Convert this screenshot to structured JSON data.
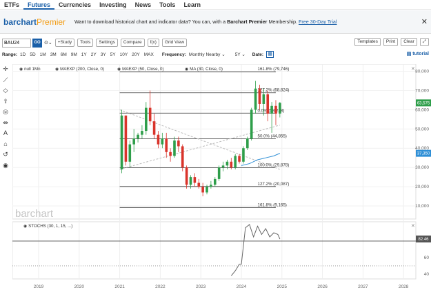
{
  "topnav": {
    "items": [
      "ETFs",
      "Futures",
      "Currencies",
      "Investing",
      "News",
      "Tools",
      "Learn"
    ],
    "active": "Futures"
  },
  "promo": {
    "logo_main": "barchart",
    "logo_accent": "Premier",
    "text": "Want to download historical chart and indicator data? You can, with a",
    "text_bold": "Barchart Premier",
    "text_after": "Membership.",
    "link": "Free 30-Day Trial",
    "close": "✕"
  },
  "toolbar": {
    "symbol": "BAU24",
    "go": "GO",
    "type_icon": "⊙⌄",
    "buttons": [
      "+Study",
      "Tools",
      "Settings",
      "Compare",
      "f(x)",
      "Grid View"
    ],
    "right_buttons": [
      "Templates",
      "Print",
      "Clear"
    ],
    "expand_icon": "⤢"
  },
  "rangebar": {
    "range_label": "Range:",
    "ranges": [
      "1D",
      "5D",
      "1M",
      "3M",
      "6M",
      "9M",
      "1Y",
      "2Y",
      "3Y",
      "5Y",
      "10Y",
      "20Y",
      "MAX"
    ],
    "freq_label": "Frequency:",
    "freq_value": "Monthly Nearby",
    "period_value": "5Y",
    "date_label": "Date:",
    "tutorial": "tutorial"
  },
  "sidetools": [
    "crosshair-icon",
    "line-icon",
    "shape-icon",
    "arrow-icon",
    "circle-icon",
    "measure-icon",
    "text-icon",
    "lock-icon",
    "undo-icon",
    "eye-icon"
  ],
  "legend": {
    "items": [
      "null 1Mn",
      "MAEXP (200, Close, 0)",
      "MAEXP (50, Close, 0)",
      "MA (30, Close, 0)"
    ]
  },
  "watermark": "barchart",
  "price_axis": [
    "80,000",
    "70,000",
    "60,000",
    "50,000",
    "40,000",
    "30,000",
    "20,000",
    "10,000"
  ],
  "price_badges": {
    "last": "63,575",
    "ma": "37,350"
  },
  "fib_levels": [
    {
      "label": "161.8% (79,746)",
      "value": 79746
    },
    {
      "label": "127.2% (68,824)",
      "value": 68824
    },
    {
      "label": "0.0% (58,238)",
      "value": 58238
    },
    {
      "label": "50.0% (44,855)",
      "value": 44855
    },
    {
      "label": "100.0% (29,878)",
      "value": 29878
    },
    {
      "label": "127.2% (20,087)",
      "value": 20087
    },
    {
      "label": "161.8% (9,165)",
      "value": 9165
    }
  ],
  "stoch": {
    "label": "STOCHS (30, 1, 15, ...)",
    "axis": [
      "80",
      "60",
      "40"
    ],
    "badge": "82.46"
  },
  "time_axis": [
    "2019",
    "2020",
    "2021",
    "2022",
    "2023",
    "2024",
    "2025",
    "2026",
    "2027",
    "2028"
  ],
  "chart_data": {
    "type": "candlestick",
    "ylim": [
      0,
      85000
    ],
    "candles": [
      {
        "t": 2021.05,
        "o": 29000,
        "h": 60000,
        "l": 27000,
        "c": 57000
      },
      {
        "t": 2021.15,
        "o": 57000,
        "h": 57000,
        "l": 31000,
        "c": 33000
      },
      {
        "t": 2021.25,
        "o": 33000,
        "h": 44000,
        "l": 30000,
        "c": 42000
      },
      {
        "t": 2021.35,
        "o": 42000,
        "h": 50000,
        "l": 38000,
        "c": 45000
      },
      {
        "t": 2021.45,
        "o": 45000,
        "h": 48000,
        "l": 43000,
        "c": 47000
      },
      {
        "t": 2021.55,
        "o": 47000,
        "h": 52000,
        "l": 45000,
        "c": 49000
      },
      {
        "t": 2021.65,
        "o": 49000,
        "h": 64000,
        "l": 47000,
        "c": 61000
      },
      {
        "t": 2021.75,
        "o": 61000,
        "h": 70000,
        "l": 52000,
        "c": 54000
      },
      {
        "t": 2021.85,
        "o": 54000,
        "h": 58000,
        "l": 45000,
        "c": 47000
      },
      {
        "t": 2021.95,
        "o": 47000,
        "h": 49000,
        "l": 40000,
        "c": 42000
      },
      {
        "t": 2022.05,
        "o": 42000,
        "h": 48000,
        "l": 40000,
        "c": 45000
      },
      {
        "t": 2022.15,
        "o": 45000,
        "h": 48000,
        "l": 35000,
        "c": 38000
      },
      {
        "t": 2022.25,
        "o": 38000,
        "h": 40000,
        "l": 33000,
        "c": 36000
      },
      {
        "t": 2022.35,
        "o": 36000,
        "h": 46000,
        "l": 35000,
        "c": 44000
      },
      {
        "t": 2022.45,
        "o": 44000,
        "h": 46000,
        "l": 38000,
        "c": 41000
      },
      {
        "t": 2022.55,
        "o": 41000,
        "h": 42000,
        "l": 28000,
        "c": 30000
      },
      {
        "t": 2022.65,
        "o": 30000,
        "h": 31000,
        "l": 19000,
        "c": 21000
      },
      {
        "t": 2022.75,
        "o": 21000,
        "h": 26000,
        "l": 19000,
        "c": 25000
      },
      {
        "t": 2022.85,
        "o": 25000,
        "h": 27000,
        "l": 20000,
        "c": 22000
      },
      {
        "t": 2022.95,
        "o": 22000,
        "h": 24000,
        "l": 19000,
        "c": 20000
      },
      {
        "t": 2023.05,
        "o": 20000,
        "h": 22000,
        "l": 15000,
        "c": 17000
      },
      {
        "t": 2023.15,
        "o": 17000,
        "h": 21000,
        "l": 16000,
        "c": 20000
      },
      {
        "t": 2023.25,
        "o": 20000,
        "h": 23000,
        "l": 19000,
        "c": 21000
      },
      {
        "t": 2023.35,
        "o": 21000,
        "h": 25000,
        "l": 20000,
        "c": 24000
      },
      {
        "t": 2023.45,
        "o": 24000,
        "h": 31000,
        "l": 23000,
        "c": 30000
      },
      {
        "t": 2023.55,
        "o": 30000,
        "h": 33000,
        "l": 28000,
        "c": 31000
      },
      {
        "t": 2023.65,
        "o": 31000,
        "h": 34000,
        "l": 29000,
        "c": 33000
      },
      {
        "t": 2023.75,
        "o": 33000,
        "h": 35000,
        "l": 29000,
        "c": 30000
      },
      {
        "t": 2023.85,
        "o": 30000,
        "h": 37000,
        "l": 29000,
        "c": 36000
      },
      {
        "t": 2023.95,
        "o": 36000,
        "h": 37000,
        "l": 32000,
        "c": 33000
      },
      {
        "t": 2024.05,
        "o": 33000,
        "h": 41000,
        "l": 32000,
        "c": 40000
      },
      {
        "t": 2024.15,
        "o": 40000,
        "h": 46000,
        "l": 39000,
        "c": 45000
      },
      {
        "t": 2024.25,
        "o": 45000,
        "h": 61000,
        "l": 44000,
        "c": 60000
      },
      {
        "t": 2024.35,
        "o": 60000,
        "h": 75000,
        "l": 58000,
        "c": 71000
      },
      {
        "t": 2024.45,
        "o": 71000,
        "h": 73000,
        "l": 60000,
        "c": 63000
      },
      {
        "t": 2024.55,
        "o": 63000,
        "h": 71000,
        "l": 57000,
        "c": 68000
      },
      {
        "t": 2024.65,
        "o": 68000,
        "h": 70000,
        "l": 54000,
        "c": 58000
      },
      {
        "t": 2024.75,
        "o": 58000,
        "h": 64000,
        "l": 48000,
        "c": 62000
      },
      {
        "t": 2024.85,
        "o": 62000,
        "h": 65000,
        "l": 52000,
        "c": 58000
      },
      {
        "t": 2024.95,
        "o": 58000,
        "h": 64000,
        "l": 56000,
        "c": 63575
      }
    ],
    "ma_line": [
      [
        2024.0,
        31000
      ],
      [
        2024.2,
        32000
      ],
      [
        2024.4,
        34000
      ],
      [
        2024.6,
        35000
      ],
      [
        2024.8,
        36000
      ],
      [
        2024.95,
        37350
      ]
    ],
    "stoch_line": [
      [
        2023.75,
        38
      ],
      [
        2023.85,
        44
      ],
      [
        2023.95,
        52
      ],
      [
        2024.0,
        52
      ],
      [
        2024.1,
        96
      ],
      [
        2024.2,
        100
      ],
      [
        2024.3,
        85
      ],
      [
        2024.4,
        98
      ],
      [
        2024.5,
        88
      ],
      [
        2024.6,
        95
      ],
      [
        2024.7,
        85
      ],
      [
        2024.8,
        90
      ],
      [
        2024.9,
        88
      ],
      [
        2024.95,
        82.46
      ]
    ]
  },
  "colors": {
    "up": "#2e9e4a",
    "down": "#d9342b",
    "ma": "#2f8fd6",
    "badge_blue": "#2f8fd6",
    "badge_green": "#2e9e4a",
    "stoch_badge": "#555555",
    "accent": "#1a5fa8"
  }
}
